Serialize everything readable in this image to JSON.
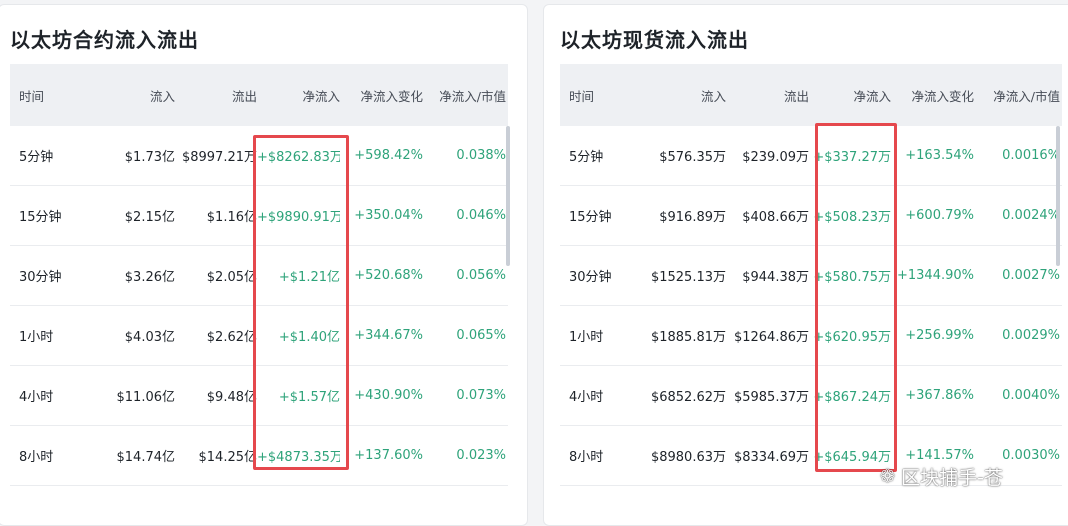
{
  "left": {
    "title": "以太坊合约流入流出",
    "headers": [
      "时间",
      "流入",
      "流出",
      "净流入",
      "净流入变化",
      "净流入/市值"
    ],
    "rows": [
      [
        "5分钟",
        "$1.73亿",
        "$8997.21万",
        "+$8262.83万",
        "+598.42%",
        "0.038%"
      ],
      [
        "15分钟",
        "$2.15亿",
        "$1.16亿",
        "+$9890.91万",
        "+350.04%",
        "0.046%"
      ],
      [
        "30分钟",
        "$3.26亿",
        "$2.05亿",
        "+$1.21亿",
        "+520.68%",
        "0.056%"
      ],
      [
        "1小时",
        "$4.03亿",
        "$2.62亿",
        "+$1.40亿",
        "+344.67%",
        "0.065%"
      ],
      [
        "4小时",
        "$11.06亿",
        "$9.48亿",
        "+$1.57亿",
        "+430.90%",
        "0.073%"
      ],
      [
        "8小时",
        "$14.74亿",
        "$14.25亿",
        "+$4873.35万",
        "+137.60%",
        "0.023%"
      ]
    ]
  },
  "right": {
    "title": "以太坊现货流入流出",
    "headers": [
      "时间",
      "流入",
      "流出",
      "净流入",
      "净流入变化",
      "净流入/市值"
    ],
    "rows": [
      [
        "5分钟",
        "$576.35万",
        "$239.09万",
        "+$337.27万",
        "+163.54%",
        "0.0016%"
      ],
      [
        "15分钟",
        "$916.89万",
        "$408.66万",
        "+$508.23万",
        "+600.79%",
        "0.0024%"
      ],
      [
        "30分钟",
        "$1525.13万",
        "$944.38万",
        "+$580.75万",
        "+1344.90%",
        "0.0027%"
      ],
      [
        "1小时",
        "$1885.81万",
        "$1264.86万",
        "+$620.95万",
        "+256.99%",
        "0.0029%"
      ],
      [
        "4小时",
        "$6852.62万",
        "$5985.37万",
        "+$867.24万",
        "+367.86%",
        "0.0040%"
      ],
      [
        "8小时",
        "$8980.63万",
        "$8334.69万",
        "+$645.94万",
        "+141.57%",
        "0.0030%"
      ]
    ]
  },
  "watermark": {
    "icon": "wechat-icon",
    "text": "区块捕手-苍"
  },
  "colors": {
    "positive": "#2ea37a",
    "highlight": "#e5484d"
  }
}
